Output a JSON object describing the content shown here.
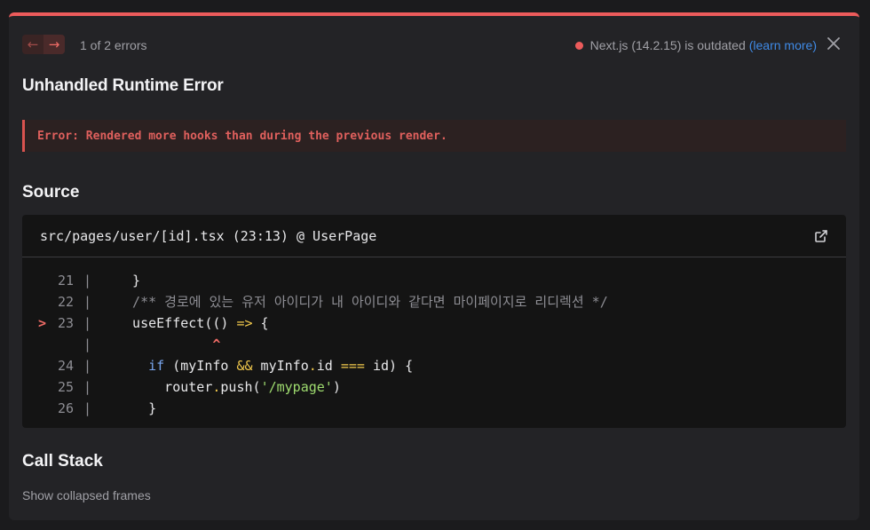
{
  "header": {
    "prev_icon": "arrow-left-icon",
    "next_icon": "arrow-right-icon",
    "error_count": "1 of 2 errors",
    "version_status": "Next.js (14.2.15) is outdated",
    "learn_more": "(learn more)",
    "close_icon": "close-icon"
  },
  "title": "Unhandled Runtime Error",
  "error_message": "Error: Rendered more hooks than during the previous render.",
  "source": {
    "section_title": "Source",
    "file_location": "src/pages/user/[id].tsx (23:13) @ UserPage",
    "open_icon": "external-link-icon",
    "lines": [
      {
        "marker": "",
        "num": "21",
        "text": "  }"
      },
      {
        "marker": "",
        "num": "22",
        "text": "  /** 경로에 있는 유저 아이디가 내 아이디와 같다면 마이페이지로 리디렉션 */"
      },
      {
        "marker": ">",
        "num": "23",
        "text": "  useEffect(() => {"
      },
      {
        "marker": "",
        "num": "",
        "text": "            ^"
      },
      {
        "marker": "",
        "num": "24",
        "text": "    if (myInfo && myInfo.id === id) {"
      },
      {
        "marker": "",
        "num": "25",
        "text": "      router.push('/mypage')"
      },
      {
        "marker": "",
        "num": "26",
        "text": "    }"
      }
    ]
  },
  "call_stack": {
    "section_title": "Call Stack",
    "show_collapsed": "Show collapsed frames"
  },
  "colors": {
    "accent": "#ec5b5b",
    "link": "#3f8ae6",
    "background": "#232326"
  }
}
